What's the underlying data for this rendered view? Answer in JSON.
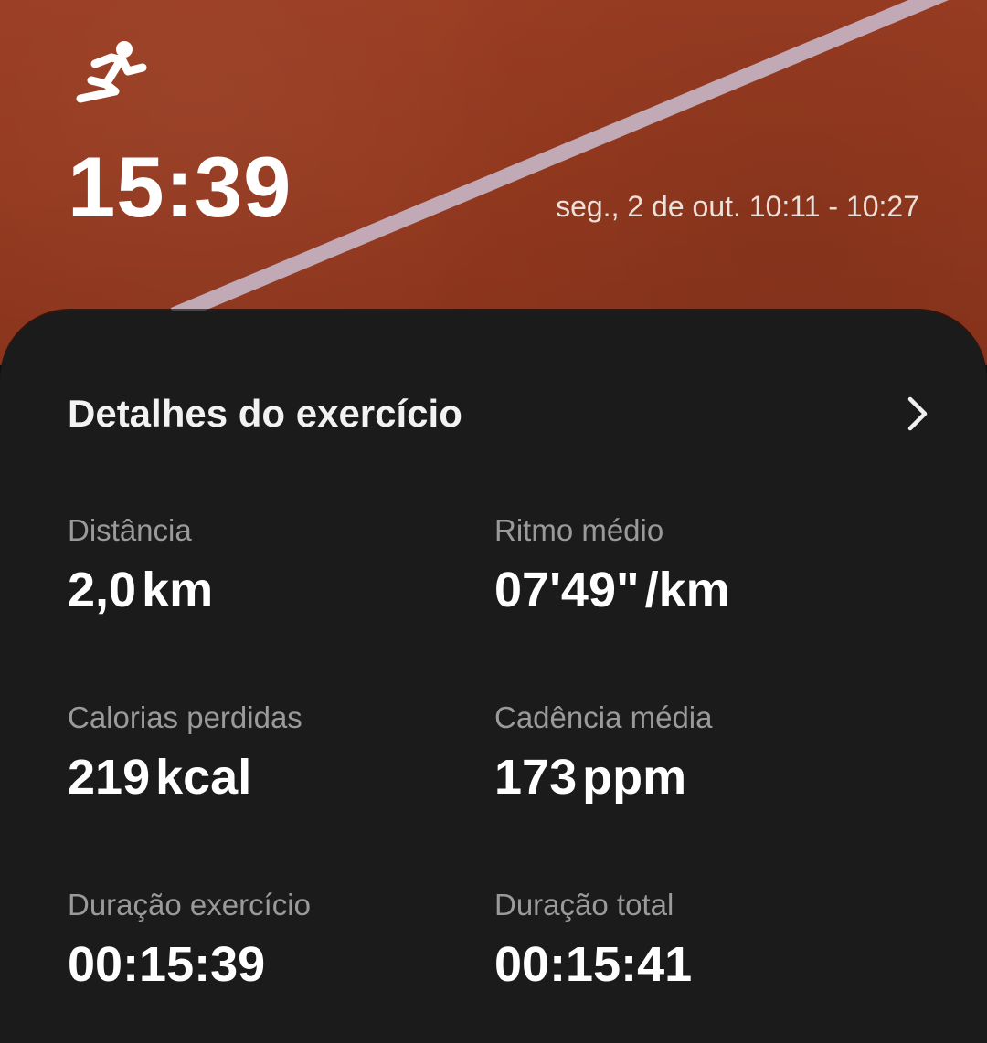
{
  "hero": {
    "icon": "running-person-icon",
    "duration": "15:39",
    "date_range": "seg., 2 de out. 10:11 - 10:27",
    "background_color": "#94391f",
    "lane_line_color": "#c9b7c4"
  },
  "details": {
    "title": "Detalhes do exercício",
    "chevron_icon": "chevron-right-icon",
    "background_color": "#1b1b1b",
    "stats": [
      {
        "label": "Distância",
        "value": "2,0",
        "unit": "km"
      },
      {
        "label": "Ritmo médio",
        "value": "07'49\"",
        "unit": "/km"
      },
      {
        "label": "Calorias perdidas",
        "value": "219",
        "unit": "kcal"
      },
      {
        "label": "Cadência média",
        "value": "173",
        "unit": "ppm"
      },
      {
        "label": "Duração exercício",
        "value": "00:15:39",
        "unit": ""
      },
      {
        "label": "Duração total",
        "value": "00:15:41",
        "unit": ""
      }
    ]
  }
}
